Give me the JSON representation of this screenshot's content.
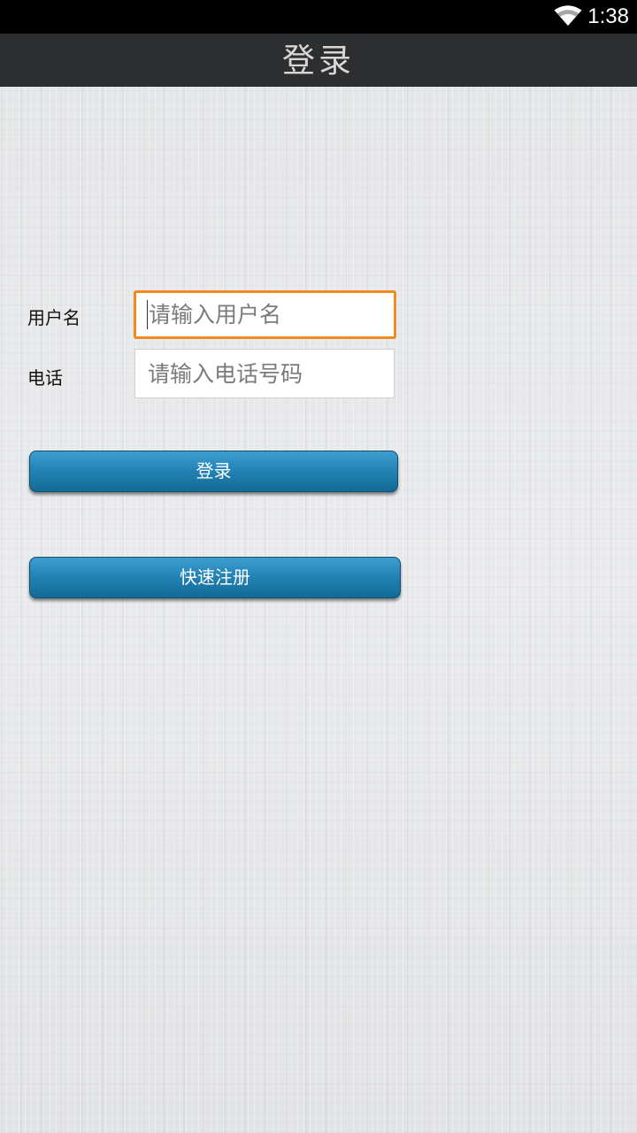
{
  "status_bar": {
    "time": "1:38",
    "icons": [
      "wifi-icon"
    ]
  },
  "title_bar": {
    "title": "登录"
  },
  "form": {
    "username": {
      "label": "用户名",
      "value": "",
      "placeholder": "请输入用户名"
    },
    "phone": {
      "label": "电话",
      "value": "",
      "placeholder": "请输入电话号码"
    },
    "login_label": "登录",
    "register_label": "快速注册"
  },
  "colors": {
    "focus_border": "#f08c1f",
    "button_blue": "#2384b7",
    "title_bar_bg": "#2d2e30",
    "status_bar_bg": "#000000"
  }
}
